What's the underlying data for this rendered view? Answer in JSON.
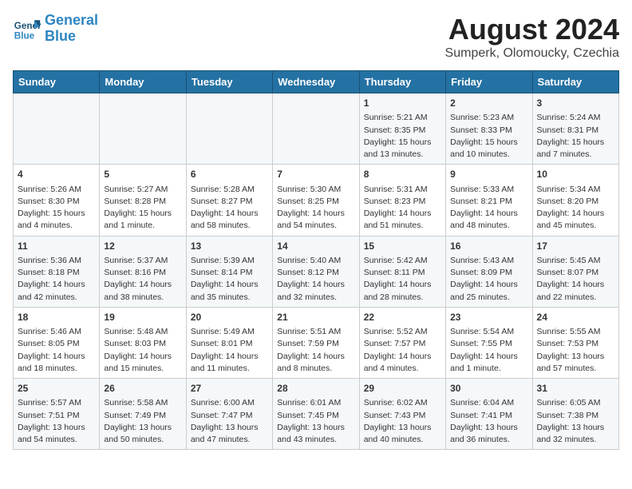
{
  "header": {
    "logo_line1": "General",
    "logo_line2": "Blue",
    "month_year": "August 2024",
    "location": "Sumperk, Olomoucky, Czechia"
  },
  "days_of_week": [
    "Sunday",
    "Monday",
    "Tuesday",
    "Wednesday",
    "Thursday",
    "Friday",
    "Saturday"
  ],
  "weeks": [
    [
      {
        "day": "",
        "content": ""
      },
      {
        "day": "",
        "content": ""
      },
      {
        "day": "",
        "content": ""
      },
      {
        "day": "",
        "content": ""
      },
      {
        "day": "1",
        "content": "Sunrise: 5:21 AM\nSunset: 8:35 PM\nDaylight: 15 hours\nand 13 minutes."
      },
      {
        "day": "2",
        "content": "Sunrise: 5:23 AM\nSunset: 8:33 PM\nDaylight: 15 hours\nand 10 minutes."
      },
      {
        "day": "3",
        "content": "Sunrise: 5:24 AM\nSunset: 8:31 PM\nDaylight: 15 hours\nand 7 minutes."
      }
    ],
    [
      {
        "day": "4",
        "content": "Sunrise: 5:26 AM\nSunset: 8:30 PM\nDaylight: 15 hours\nand 4 minutes."
      },
      {
        "day": "5",
        "content": "Sunrise: 5:27 AM\nSunset: 8:28 PM\nDaylight: 15 hours\nand 1 minute."
      },
      {
        "day": "6",
        "content": "Sunrise: 5:28 AM\nSunset: 8:27 PM\nDaylight: 14 hours\nand 58 minutes."
      },
      {
        "day": "7",
        "content": "Sunrise: 5:30 AM\nSunset: 8:25 PM\nDaylight: 14 hours\nand 54 minutes."
      },
      {
        "day": "8",
        "content": "Sunrise: 5:31 AM\nSunset: 8:23 PM\nDaylight: 14 hours\nand 51 minutes."
      },
      {
        "day": "9",
        "content": "Sunrise: 5:33 AM\nSunset: 8:21 PM\nDaylight: 14 hours\nand 48 minutes."
      },
      {
        "day": "10",
        "content": "Sunrise: 5:34 AM\nSunset: 8:20 PM\nDaylight: 14 hours\nand 45 minutes."
      }
    ],
    [
      {
        "day": "11",
        "content": "Sunrise: 5:36 AM\nSunset: 8:18 PM\nDaylight: 14 hours\nand 42 minutes."
      },
      {
        "day": "12",
        "content": "Sunrise: 5:37 AM\nSunset: 8:16 PM\nDaylight: 14 hours\nand 38 minutes."
      },
      {
        "day": "13",
        "content": "Sunrise: 5:39 AM\nSunset: 8:14 PM\nDaylight: 14 hours\nand 35 minutes."
      },
      {
        "day": "14",
        "content": "Sunrise: 5:40 AM\nSunset: 8:12 PM\nDaylight: 14 hours\nand 32 minutes."
      },
      {
        "day": "15",
        "content": "Sunrise: 5:42 AM\nSunset: 8:11 PM\nDaylight: 14 hours\nand 28 minutes."
      },
      {
        "day": "16",
        "content": "Sunrise: 5:43 AM\nSunset: 8:09 PM\nDaylight: 14 hours\nand 25 minutes."
      },
      {
        "day": "17",
        "content": "Sunrise: 5:45 AM\nSunset: 8:07 PM\nDaylight: 14 hours\nand 22 minutes."
      }
    ],
    [
      {
        "day": "18",
        "content": "Sunrise: 5:46 AM\nSunset: 8:05 PM\nDaylight: 14 hours\nand 18 minutes."
      },
      {
        "day": "19",
        "content": "Sunrise: 5:48 AM\nSunset: 8:03 PM\nDaylight: 14 hours\nand 15 minutes."
      },
      {
        "day": "20",
        "content": "Sunrise: 5:49 AM\nSunset: 8:01 PM\nDaylight: 14 hours\nand 11 minutes."
      },
      {
        "day": "21",
        "content": "Sunrise: 5:51 AM\nSunset: 7:59 PM\nDaylight: 14 hours\nand 8 minutes."
      },
      {
        "day": "22",
        "content": "Sunrise: 5:52 AM\nSunset: 7:57 PM\nDaylight: 14 hours\nand 4 minutes."
      },
      {
        "day": "23",
        "content": "Sunrise: 5:54 AM\nSunset: 7:55 PM\nDaylight: 14 hours\nand 1 minute."
      },
      {
        "day": "24",
        "content": "Sunrise: 5:55 AM\nSunset: 7:53 PM\nDaylight: 13 hours\nand 57 minutes."
      }
    ],
    [
      {
        "day": "25",
        "content": "Sunrise: 5:57 AM\nSunset: 7:51 PM\nDaylight: 13 hours\nand 54 minutes."
      },
      {
        "day": "26",
        "content": "Sunrise: 5:58 AM\nSunset: 7:49 PM\nDaylight: 13 hours\nand 50 minutes."
      },
      {
        "day": "27",
        "content": "Sunrise: 6:00 AM\nSunset: 7:47 PM\nDaylight: 13 hours\nand 47 minutes."
      },
      {
        "day": "28",
        "content": "Sunrise: 6:01 AM\nSunset: 7:45 PM\nDaylight: 13 hours\nand 43 minutes."
      },
      {
        "day": "29",
        "content": "Sunrise: 6:02 AM\nSunset: 7:43 PM\nDaylight: 13 hours\nand 40 minutes."
      },
      {
        "day": "30",
        "content": "Sunrise: 6:04 AM\nSunset: 7:41 PM\nDaylight: 13 hours\nand 36 minutes."
      },
      {
        "day": "31",
        "content": "Sunrise: 6:05 AM\nSunset: 7:38 PM\nDaylight: 13 hours\nand 32 minutes."
      }
    ]
  ]
}
